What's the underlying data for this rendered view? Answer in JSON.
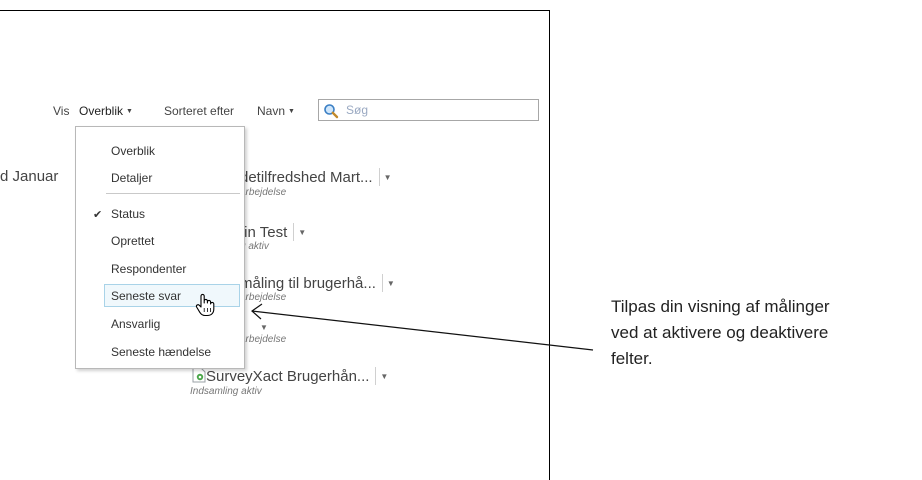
{
  "toolbar": {
    "vis_label": "Vis",
    "view_selected": "Overblik",
    "sort_label": "Sorteret efter",
    "sort_selected": "Navn",
    "search_placeholder": "Søg"
  },
  "background_items": [
    {
      "title": "d Januar"
    },
    {
      "title": "detilfredshed Mart...",
      "subtitle": "arbejdelse"
    },
    {
      "title": "tin Test",
      "subtitle": "g aktiv"
    },
    {
      "title": "måling til brugerhå...",
      "subtitle": "arbejdelse"
    },
    {
      "title": "",
      "subtitle": "arbejdelse"
    },
    {
      "title": "SurveyXact Brugerhån...",
      "subtitle": "Indsamling aktiv"
    }
  ],
  "menu": {
    "view_options": [
      "Overblik",
      "Detaljer"
    ],
    "field_options": [
      {
        "label": "Status",
        "checked": true
      },
      {
        "label": "Oprettet",
        "checked": false
      },
      {
        "label": "Respondenter",
        "checked": false
      },
      {
        "label": "Seneste svar",
        "checked": false,
        "hovered": true
      },
      {
        "label": "Ansvarlig",
        "checked": false
      },
      {
        "label": "Seneste hændelse",
        "checked": false
      }
    ]
  },
  "callout": {
    "lines": [
      "Tilpas din visning af målinger",
      "ved at aktivere og deaktivere",
      "felter."
    ]
  }
}
